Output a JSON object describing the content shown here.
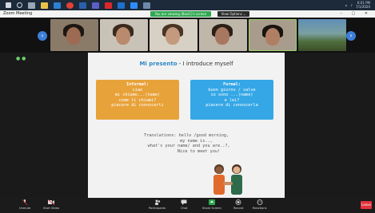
{
  "taskbar": {
    "time": "6:01 PM",
    "date": "7/1/2020"
  },
  "zoom": {
    "app_title": "Zoom Meeting",
    "share_banner": "You are viewing (BasiC)'s screen",
    "view_options": "View Options ⌄"
  },
  "slide": {
    "title_it": "Mi presento",
    "title_en": " - I introduce myself",
    "informal": {
      "heading": "Informal:",
      "lines": [
        "ciao",
        "mi chiamo...(name)",
        "come ti chiami?",
        "piacere di conoscerti"
      ]
    },
    "formal": {
      "heading": "Formal:",
      "lines": [
        "buon giorno / salve",
        "io sono ...(name)",
        "e lei?",
        "piacere di conoscerla"
      ]
    },
    "translation": "Translations: hello /good morning,\n        my name is..,\n  what's your name/ and you are..?,\n          Nice to meet you!"
  },
  "toolbar": {
    "items": [
      "Unmute",
      "Start Video",
      "Participants",
      "Chat",
      "Share Screen",
      "Record",
      "Reactions"
    ],
    "participants_count": "3",
    "leave": "Leave"
  },
  "colors": {
    "informal_box": "#e8a23a",
    "formal_box": "#35a7e6",
    "share_banner": "#2fa84f",
    "leave": "#e0323c",
    "nav_arrow": "#3d7fd8"
  }
}
